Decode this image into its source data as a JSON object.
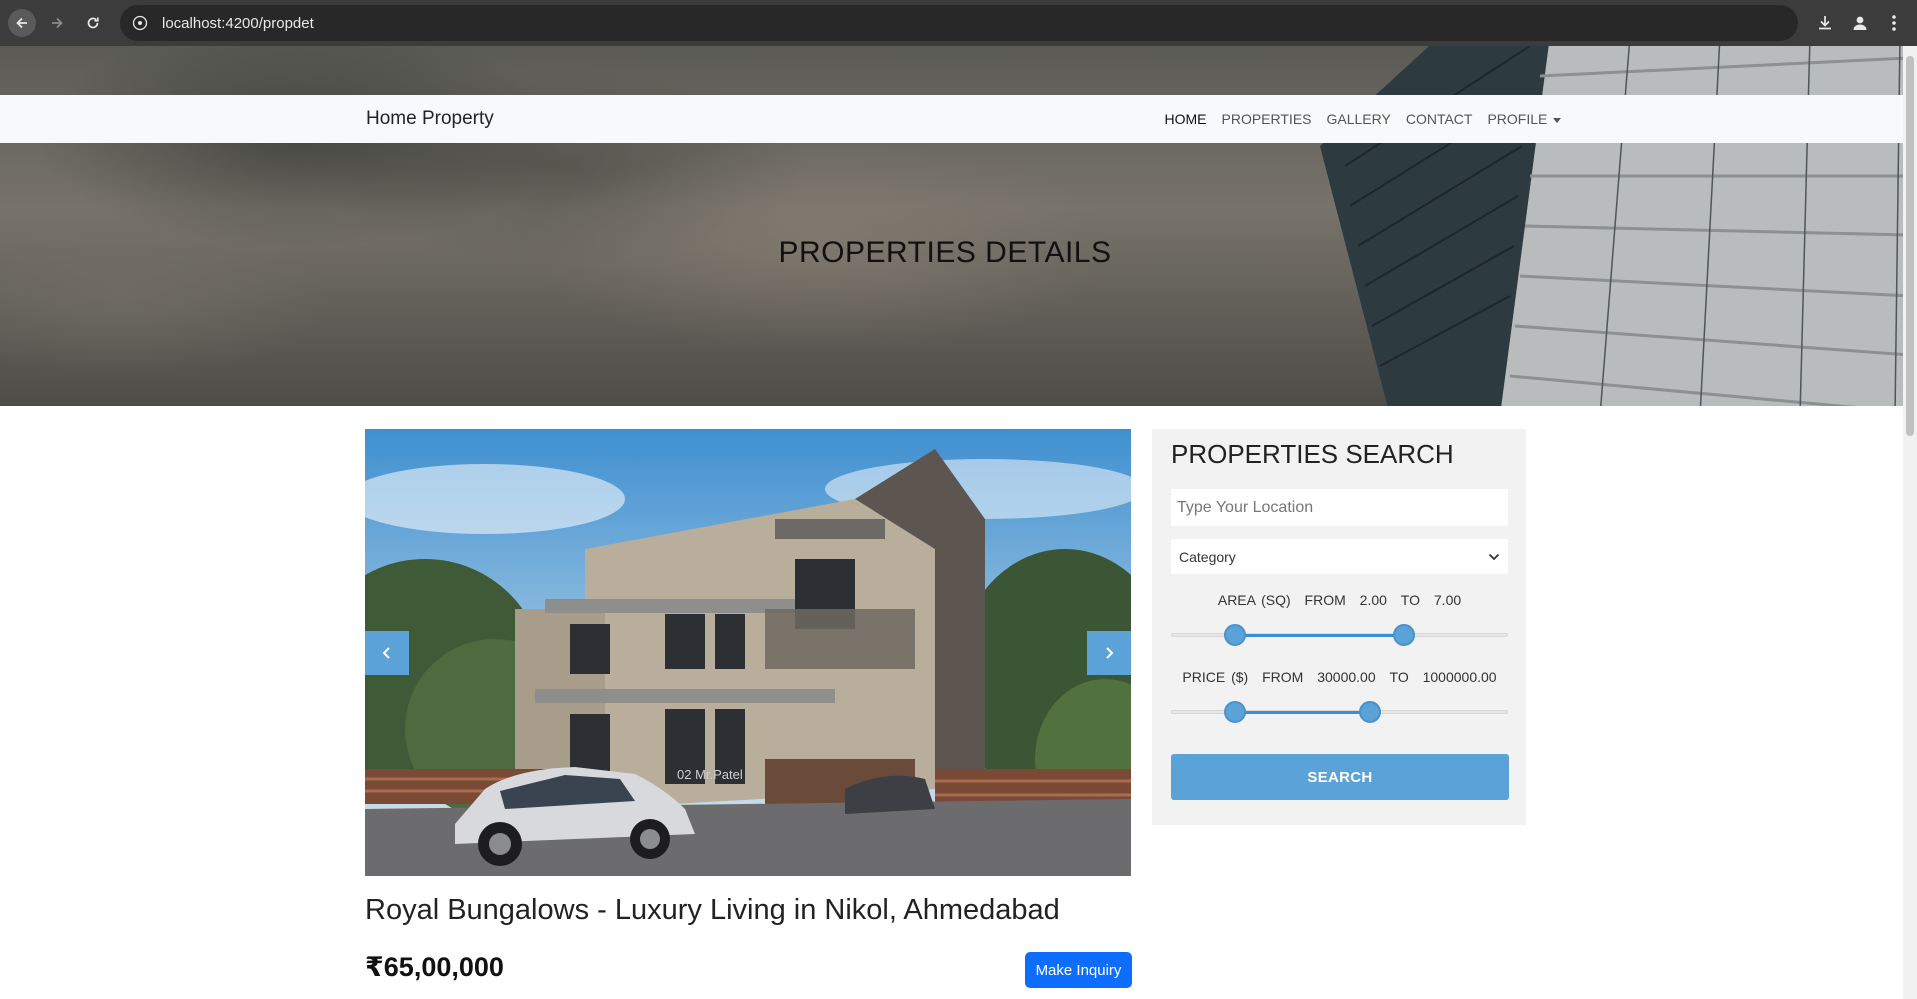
{
  "browser": {
    "url": "localhost:4200/propdet",
    "icons": [
      "back-arrow-icon",
      "forward-arrow-icon",
      "reload-icon",
      "site-info-icon",
      "download-icon",
      "account-icon",
      "kebab-menu-icon"
    ]
  },
  "nav": {
    "brand": "Home Property",
    "items": [
      {
        "label": "HOME",
        "active": true
      },
      {
        "label": "PROPERTIES"
      },
      {
        "label": "GALLERY"
      },
      {
        "label": "CONTACT"
      },
      {
        "label": "PROFILE",
        "dropdown": true
      }
    ]
  },
  "hero": {
    "title": "PROPERTIES DETAILS"
  },
  "property": {
    "title": "Royal Bungalows - Luxury Living in Nikol, Ahmedabad",
    "price": "₹65,00,000",
    "inquiry_label": "Make Inquiry",
    "image_sign": "02 Mr.Patel"
  },
  "search": {
    "title": "PROPERTIES SEARCH",
    "location_placeholder": "Type Your Location",
    "category_selected": "Category",
    "area": {
      "label": "AREA (SQ)",
      "from_label": "FROM",
      "to_label": "TO",
      "from": "2.00",
      "to": "7.00",
      "min_frac": 0.19,
      "max_frac": 0.69
    },
    "price": {
      "label": "PRICE ($)",
      "from_label": "FROM",
      "to_label": "TO",
      "from": "30000.00",
      "to": "1000000.00",
      "min_frac": 0.19,
      "max_frac": 0.59
    },
    "button_label": "SEARCH"
  },
  "colors": {
    "accent": "#5aa2d8",
    "primary_button": "#0d6efd",
    "navbar": "#f8f9fa",
    "panel": "#f2f2f2"
  }
}
